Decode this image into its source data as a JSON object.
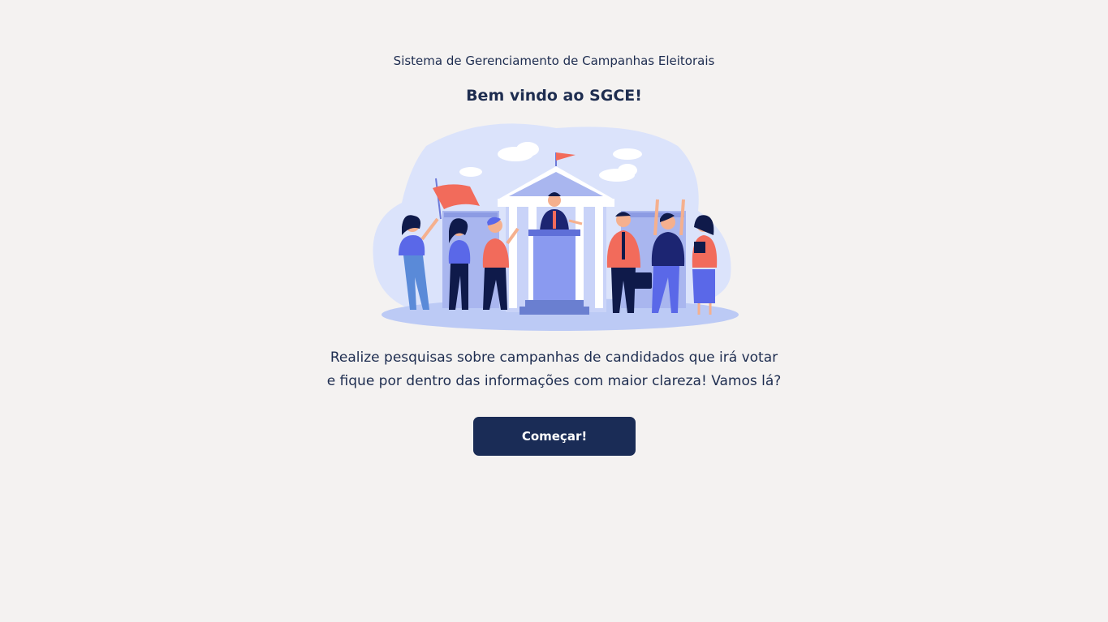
{
  "header": {
    "system_title": "Sistema de Gerenciamento de Campanhas Eleitorais",
    "welcome_title": "Bem vindo ao SGCE!"
  },
  "illustration": {
    "icon": "election-campaign-illustration"
  },
  "intro": {
    "line1": "Realize pesquisas sobre campanhas de candidados que irá votar",
    "line2": "e fique por dentro das informações com maior clareza! Vamos lá?"
  },
  "actions": {
    "start_label": "Começar!"
  },
  "colors": {
    "background": "#f4f2f1",
    "text": "#1e2d50",
    "button": "#1a2c56",
    "button_text": "#ffffff",
    "accent_coral": "#f26b5b",
    "accent_blue": "#5a68e8",
    "pale_blue": "#d6def9"
  }
}
